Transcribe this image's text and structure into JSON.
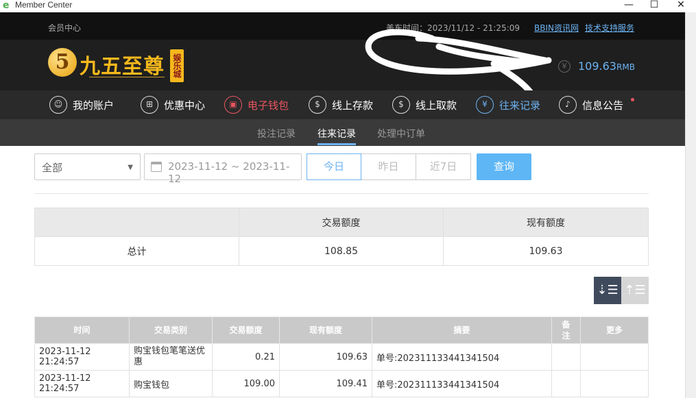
{
  "window": {
    "title": "Member Center"
  },
  "topbar": {
    "member_center": "会员中心",
    "time_label": "美东时间：2023/11/12 - 21:25:09",
    "link_news": "BBIN资讯网",
    "link_support": "技术支持服务"
  },
  "header": {
    "logo_mark": "5",
    "logo_text": "九五至尊",
    "logo_badge": "娱乐城",
    "balance": "109.63",
    "balance_unit": "RMB"
  },
  "nav": {
    "items": [
      {
        "label": "我的账户",
        "icon": "user-icon"
      },
      {
        "label": "优惠中心",
        "icon": "gift-icon"
      },
      {
        "label": "电子钱包",
        "icon": "wallet-icon"
      },
      {
        "label": "线上存款",
        "icon": "deposit-icon"
      },
      {
        "label": "线上取款",
        "icon": "withdraw-icon"
      },
      {
        "label": "往来记录",
        "icon": "record-icon"
      },
      {
        "label": "信息公告",
        "icon": "bell-icon"
      }
    ]
  },
  "subnav": {
    "items": [
      "投注记录",
      "往来记录",
      "处理中订单"
    ]
  },
  "filter": {
    "type_value": "全部",
    "date_range": "2023-11-12 ~ 2023-11-12",
    "quick": [
      "今日",
      "昨日",
      "近7日"
    ],
    "query_label": "查询"
  },
  "summary": {
    "headers": [
      "",
      "交易额度",
      "现有额度"
    ],
    "row": [
      "总计",
      "108.85",
      "109.63"
    ]
  },
  "table": {
    "headers": [
      "时间",
      "交易类别",
      "交易额度",
      "现有额度",
      "摘要",
      "备注",
      "更多"
    ],
    "rows": [
      [
        "2023-11-12 21:24:57",
        "购宝钱包笔笔送优惠",
        "0.21",
        "109.63",
        "单号:202311133441341504",
        "",
        ""
      ],
      [
        "2023-11-12 21:24:57",
        "购宝钱包",
        "109.00",
        "109.41",
        "单号:202311133441341504",
        "",
        ""
      ]
    ]
  }
}
